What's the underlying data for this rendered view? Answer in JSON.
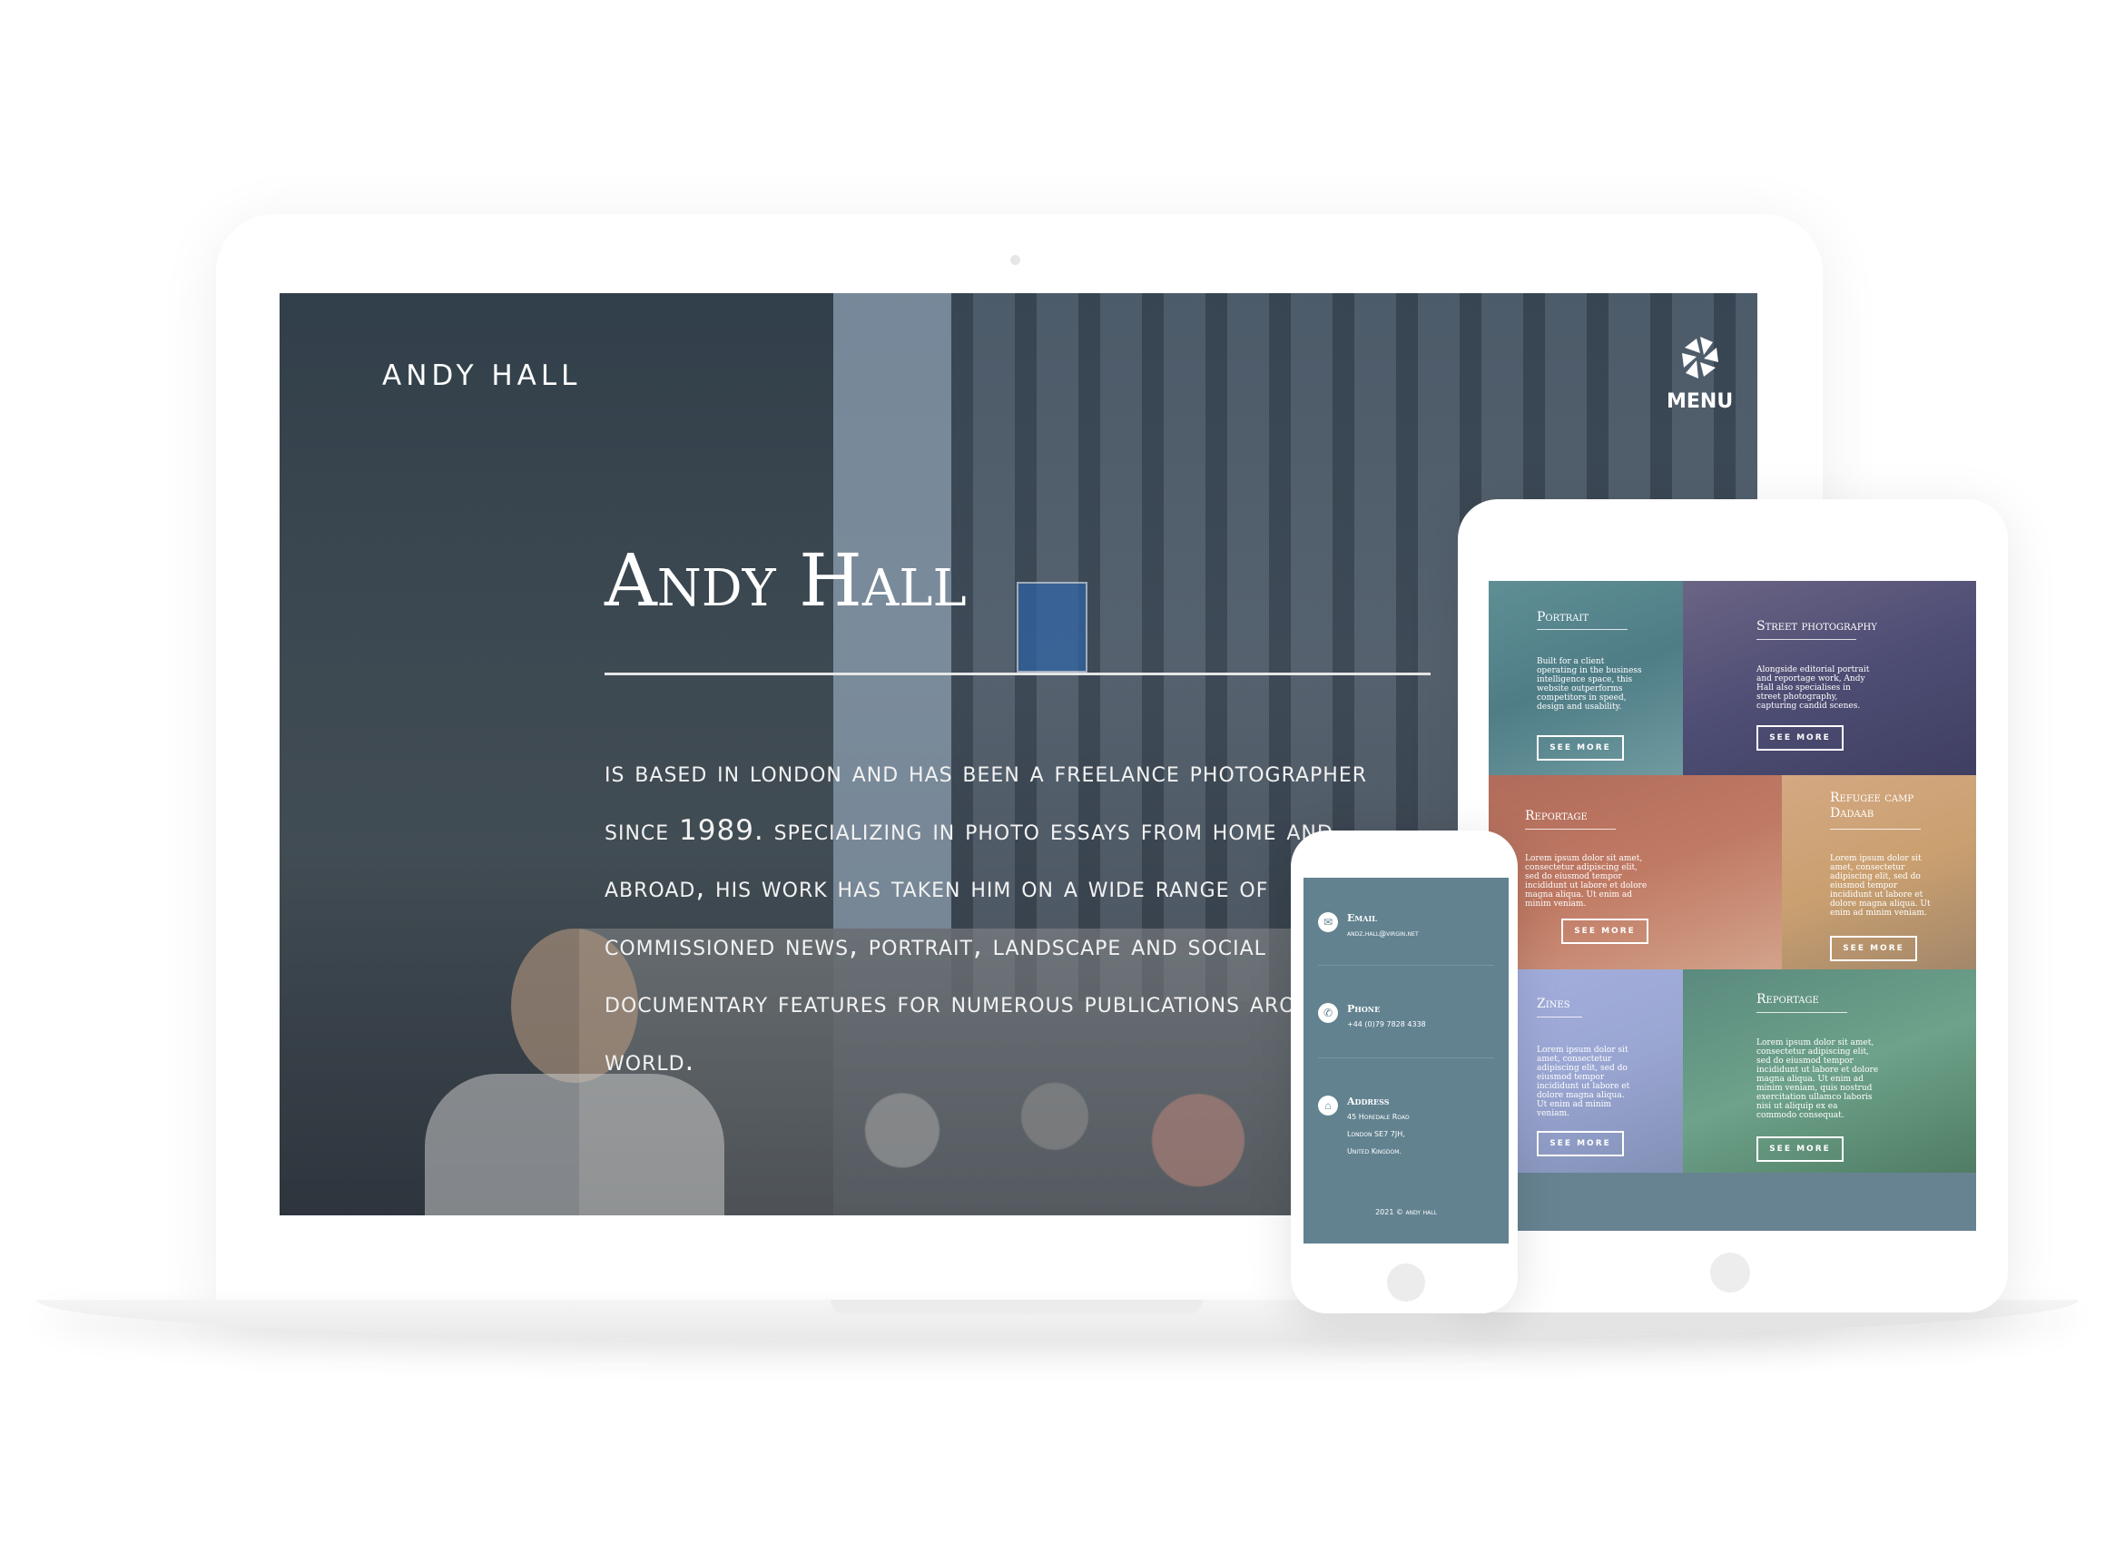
{
  "desktop": {
    "brand": "ANDY HALL",
    "menu_label": "MENU",
    "hero_title": "Andy Hall",
    "hero_text": "is based in London and has been a freelance photographer since 1989. Specializing in photo essays from home and abroad, his work has taken him on a wide range of commissioned news, portrait, landscape and social documentary features for numerous publications around the world."
  },
  "tablet": {
    "tiles": [
      {
        "name": "Portrait",
        "desc": "Built for a client operating in the business intelligence space, this website outperforms competitors in speed, design and usability.",
        "button": "SEE MORE"
      },
      {
        "name": "Street photography",
        "desc": "Alongside editorial portrait and reportage work, Andy Hall also specialises in street photography, capturing candid scenes.",
        "button": "SEE MORE"
      },
      {
        "name": "Reportage",
        "desc": "Lorem ipsum dolor sit amet, consectetur adipiscing elit, sed do eiusmod tempor incididunt ut labore et dolore magna aliqua. Ut enim ad minim veniam.",
        "button": "SEE MORE"
      },
      {
        "name": "Refugee camp Dadaab",
        "desc": "Lorem ipsum dolor sit amet, consectetur adipiscing elit, sed do eiusmod tempor incididunt ut labore et dolore magna aliqua. Ut enim ad minim veniam.",
        "button": "SEE MORE"
      },
      {
        "name": "Zines",
        "desc": "Lorem ipsum dolor sit amet, consectetur adipiscing elit, sed do eiusmod tempor incididunt ut labore et dolore magna aliqua. Ut enim ad minim veniam.",
        "button": "SEE MORE"
      },
      {
        "name": "Reportage",
        "desc": "Lorem ipsum dolor sit amet, consectetur adipiscing elit, sed do eiusmod tempor incididunt ut labore et dolore magna aliqua. Ut enim ad minim veniam, quis nostrud exercitation ullamco laboris nisi ut aliquip ex ea commodo consequat.",
        "button": "SEE MORE"
      }
    ]
  },
  "phone": {
    "email": {
      "icon": "envelope-icon",
      "label": "Email",
      "value": "andz.hall@virgin.net"
    },
    "phone": {
      "icon": "phone-icon",
      "label": "Phone",
      "value": "+44 (0)79 7828 4338"
    },
    "address": {
      "icon": "home-icon",
      "label": "Address",
      "lines": [
        "45 Horedale Road",
        "London SE7 7JH,",
        "United Kingdom."
      ]
    },
    "footer": "2021 © andy hall"
  },
  "colors": {
    "contact_bg": "#628290",
    "tablet_bg": "#678391",
    "hero_overlay": "#2b3a4b"
  }
}
